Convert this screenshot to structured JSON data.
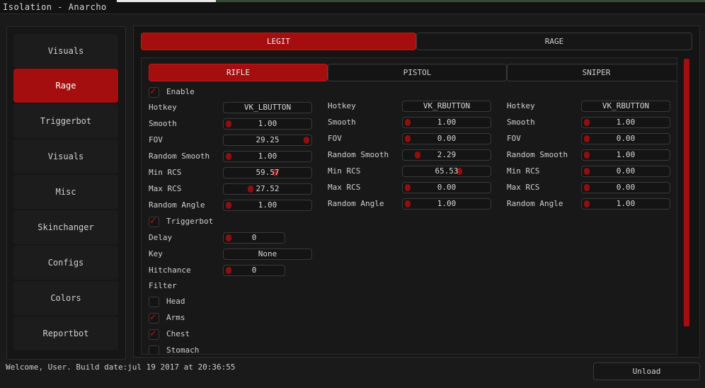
{
  "window_title": "Isolation - Anarcho",
  "sidebar": {
    "items": [
      {
        "label": "Visuals",
        "active": false
      },
      {
        "label": "Rage",
        "active": true
      },
      {
        "label": "Triggerbot",
        "active": false
      },
      {
        "label": "Visuals",
        "active": false
      },
      {
        "label": "Misc",
        "active": false
      },
      {
        "label": "Skinchanger",
        "active": false
      },
      {
        "label": "Configs",
        "active": false
      },
      {
        "label": "Colors",
        "active": false
      },
      {
        "label": "Reportbot",
        "active": false
      }
    ]
  },
  "top_tabs": [
    {
      "label": "LEGIT",
      "active": true
    },
    {
      "label": "RAGE",
      "active": false
    }
  ],
  "weapon_tabs": [
    {
      "label": "RIFLE",
      "active": true
    },
    {
      "label": "PISTOL",
      "active": false
    },
    {
      "label": "SNIPER",
      "active": false
    }
  ],
  "enable": {
    "label": "Enable",
    "checked": true
  },
  "columns": [
    {
      "hotkey_label": "Hotkey",
      "hotkey_value": "VK_LBUTTON",
      "sliders": [
        {
          "label": "Smooth",
          "value": "1.00",
          "fraction": 0.0
        },
        {
          "label": "FOV",
          "value": "29.25",
          "fraction": 1.0
        },
        {
          "label": "Random Smooth",
          "value": "1.00",
          "fraction": 0.0
        },
        {
          "label": "Min RCS",
          "value": "59.57",
          "fraction": 0.6
        },
        {
          "label": "Max RCS",
          "value": "27.52",
          "fraction": 0.28
        },
        {
          "label": "Random Angle",
          "value": "1.00",
          "fraction": 0.0
        }
      ]
    },
    {
      "hotkey_label": "Hotkey",
      "hotkey_value": "VK_RBUTTON",
      "sliders": [
        {
          "label": "Smooth",
          "value": "1.00",
          "fraction": 0.0
        },
        {
          "label": "FOV",
          "value": "0.00",
          "fraction": 0.0
        },
        {
          "label": "Random Smooth",
          "value": "2.29",
          "fraction": 0.13
        },
        {
          "label": "Min RCS",
          "value": "65.53",
          "fraction": 0.66
        },
        {
          "label": "Max RCS",
          "value": "0.00",
          "fraction": 0.0
        },
        {
          "label": "Random Angle",
          "value": "1.00",
          "fraction": 0.0
        }
      ]
    },
    {
      "hotkey_label": "Hotkey",
      "hotkey_value": "VK_RBUTTON",
      "sliders": [
        {
          "label": "Smooth",
          "value": "1.00",
          "fraction": 0.0
        },
        {
          "label": "FOV",
          "value": "0.00",
          "fraction": 0.0
        },
        {
          "label": "Random Smooth",
          "value": "1.00",
          "fraction": 0.0
        },
        {
          "label": "Min RCS",
          "value": "0.00",
          "fraction": 0.0
        },
        {
          "label": "Max RCS",
          "value": "0.00",
          "fraction": 0.0
        },
        {
          "label": "Random Angle",
          "value": "1.00",
          "fraction": 0.0
        }
      ]
    }
  ],
  "triggerbot": {
    "label": "Triggerbot",
    "checked": true,
    "delay_label": "Delay",
    "delay_value": "0",
    "key_label": "Key",
    "key_value": "None",
    "hitchance_label": "Hitchance",
    "hitchance_value": "0"
  },
  "filter": {
    "label": "Filter",
    "items": [
      {
        "label": "Head",
        "checked": false
      },
      {
        "label": "Arms",
        "checked": true
      },
      {
        "label": "Chest",
        "checked": true
      },
      {
        "label": "Stomach",
        "checked": false
      }
    ]
  },
  "status_text": "Welcome, User. Build date:jul 19 2017 at 20:36:55",
  "unload_label": "Unload",
  "colors": {
    "accent": "#a40e0e",
    "background": "#1a1a1a",
    "knob": "#8f0f0f"
  }
}
